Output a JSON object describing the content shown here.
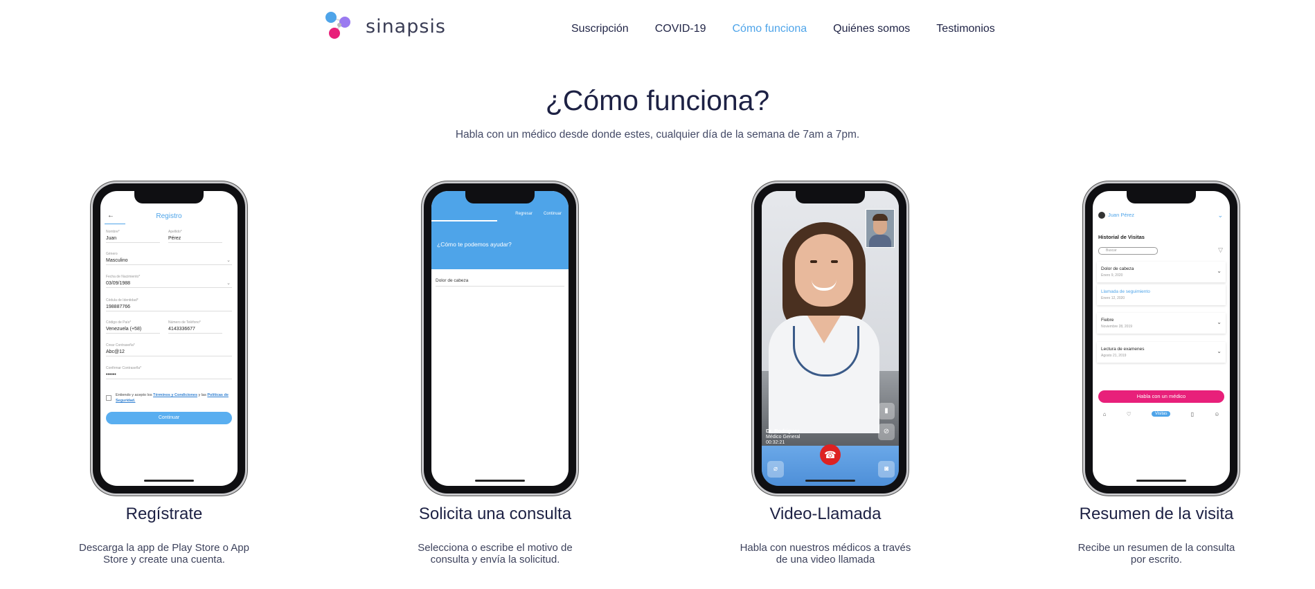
{
  "header": {
    "logo_text": "sinapsis",
    "nav": [
      "Suscripción",
      "COVID-19",
      "Cómo funciona",
      "Quiénes somos",
      "Testimonios"
    ],
    "active_nav": "Cómo funciona"
  },
  "hero": {
    "title": "¿Cómo funciona?",
    "subtitle": "Habla con un médico desde donde estes, cualquier día de la semana de 7am a 7pm."
  },
  "steps": [
    {
      "title": "Regístrate",
      "description": "Descarga la app de Play Store o App Store y create una cuenta."
    },
    {
      "title": "Solicita una consulta",
      "description": "Selecciona o escribe el motivo de consulta y envía la solicitud."
    },
    {
      "title": "Video-Llamada",
      "description": "Habla con nuestros médicos a través de una video llamada"
    },
    {
      "title": "Resumen de la visita",
      "description": "Recibe un resumen de la consulta por escrito."
    }
  ],
  "screen_registro": {
    "title": "Registro",
    "fields": {
      "nombre_label": "Nombre*",
      "nombre": "Juan",
      "apellido_label": "Apellido*",
      "apellido": "Pérez",
      "genero_label": "Género",
      "genero": "Masculino",
      "fecha_label": "Fecha de Nacimiento*",
      "fecha": "03/09/1988",
      "cedula_label": "Cédula de Identidad*",
      "cedula": "198887766",
      "codigo_label": "Código de País*",
      "codigo": "Venezuela (+58)",
      "telefono_label": "Número de Teléfono*",
      "telefono": "4143336677",
      "crear_label": "Crear Contraseña*",
      "crear": "Abc@12",
      "confirmar_label": "Confirmar Contraseña*",
      "confirmar": "••••••"
    },
    "terms_pre": "Entiendo y acepto los ",
    "terms_link1": "Términos y Condiciones",
    "terms_mid": " y las ",
    "terms_link2": "Políticas de Seguridad.",
    "button": "Continuar"
  },
  "screen_consulta": {
    "tab_back": "Regresar",
    "tab_next": "Continuar",
    "question": "¿Cómo te podemos ayudar?",
    "answer": "Dolor de cabeza"
  },
  "screen_video": {
    "doctor": "Dr. Rodriguez",
    "role": "Médico General",
    "time": "00:32:21"
  },
  "screen_resumen": {
    "user": "Juan Pérez",
    "heading": "Historial de Visitas",
    "search_placeholder": "Buscar",
    "items": [
      {
        "title": "Dolor de cabeza",
        "date": "Enero 9, 2020"
      },
      {
        "title": "Llamada de seguimiento",
        "date": "Enero 12, 2020"
      },
      {
        "title": "Fiebre",
        "date": "Noviembre 28, 2019"
      },
      {
        "title": "Lectura de examenes",
        "date": "Agosto 21, 2019"
      }
    ],
    "button": "Habla con un médico",
    "tab_active": "Visitas"
  }
}
